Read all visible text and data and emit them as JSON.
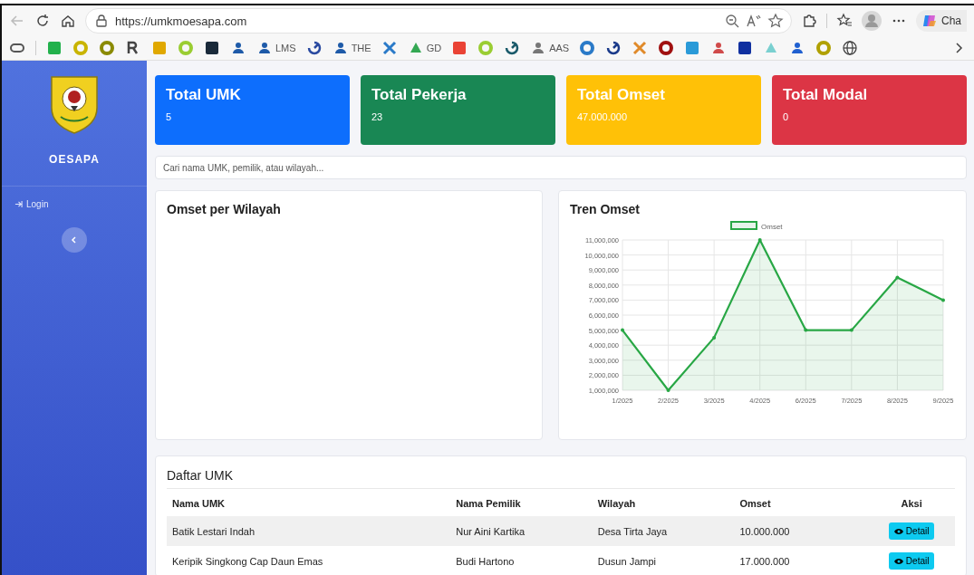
{
  "browser": {
    "url": "https://umkmoesapa.com",
    "copilot_label": "Cha",
    "bookmarks": [
      {
        "kind": "pill",
        "color": "#555555"
      },
      {
        "kind": "square",
        "color": "#22b14c"
      },
      {
        "kind": "ring",
        "color": "#c9b400"
      },
      {
        "kind": "ring",
        "color": "#8a8a00"
      },
      {
        "kind": "letter",
        "color": "#444444"
      },
      {
        "kind": "square",
        "color": "#e0a800"
      },
      {
        "kind": "ring",
        "color": "#9acd32"
      },
      {
        "kind": "square",
        "color": "#1a2a3a"
      },
      {
        "kind": "person",
        "color": "#1e5aa8"
      },
      {
        "kind": "person",
        "color": "#1e5aa8",
        "label": "LMS"
      },
      {
        "kind": "swirl",
        "color": "#2a4aa0"
      },
      {
        "kind": "person",
        "color": "#1e5aa8",
        "label": "THE"
      },
      {
        "kind": "cross",
        "color": "#2a7ac8"
      },
      {
        "kind": "triangle",
        "color": "#34a853",
        "label": "GD"
      },
      {
        "kind": "square",
        "color": "#ea4335"
      },
      {
        "kind": "ring",
        "color": "#9acd32"
      },
      {
        "kind": "swirl",
        "color": "#1a5a6a"
      },
      {
        "kind": "person",
        "color": "#777777",
        "label": "AAS"
      },
      {
        "kind": "ring",
        "color": "#2a7ac8"
      },
      {
        "kind": "swirl",
        "color": "#1a3a8a"
      },
      {
        "kind": "cross",
        "color": "#e08a2a"
      },
      {
        "kind": "ring",
        "color": "#a01010"
      },
      {
        "kind": "square",
        "color": "#2a9ad8"
      },
      {
        "kind": "person",
        "color": "#d04a4a"
      },
      {
        "kind": "square",
        "color": "#1030a0"
      },
      {
        "kind": "triangle",
        "color": "#7ad0d0"
      },
      {
        "kind": "person",
        "color": "#2060d0"
      },
      {
        "kind": "ring",
        "color": "#b0a000"
      },
      {
        "kind": "globe",
        "color": "#444444"
      }
    ]
  },
  "sidebar": {
    "brand": "OESAPA",
    "login": "Login"
  },
  "stats": [
    {
      "title": "Total UMK",
      "value": "5",
      "color": "#0d6efd"
    },
    {
      "title": "Total Pekerja",
      "value": "23",
      "color": "#198754"
    },
    {
      "title": "Total Omset",
      "value": "47.000.000",
      "color": "#ffc107"
    },
    {
      "title": "Total Modal",
      "value": "0",
      "color": "#dc3545"
    }
  ],
  "search": {
    "placeholder": "Cari nama UMK, pemilik, atau wilayah..."
  },
  "region_panel": {
    "title": "Omset per Wilayah"
  },
  "trend_panel": {
    "title": "Tren Omset",
    "chart_data": {
      "type": "area",
      "grid": true,
      "categories": [
        "1/2025",
        "2/2025",
        "3/2025",
        "4/2025",
        "6/2025",
        "7/2025",
        "8/2025",
        "9/2025"
      ],
      "series": [
        {
          "name": "Omset",
          "color": "#28a745",
          "values": [
            5000000,
            1000000,
            4500000,
            11000000,
            5000000,
            5000000,
            8500000,
            7000000
          ]
        }
      ],
      "ylim": [
        1000000,
        11000000
      ],
      "yticks": [
        {
          "value": 1000000,
          "label": "1,000,000"
        },
        {
          "value": 2000000,
          "label": "2,000,000"
        },
        {
          "value": 3000000,
          "label": "3,000,000"
        },
        {
          "value": 4000000,
          "label": "4,000,000"
        },
        {
          "value": 5000000,
          "label": "5,000,000"
        },
        {
          "value": 6000000,
          "label": "6,000,000"
        },
        {
          "value": 7000000,
          "label": "7,000,000"
        },
        {
          "value": 8000000,
          "label": "8,000,000"
        },
        {
          "value": 9000000,
          "label": "9,000,000"
        },
        {
          "value": 10000000,
          "label": "10,000,000"
        },
        {
          "value": 11000000,
          "label": "11,000,000"
        }
      ]
    }
  },
  "table": {
    "title": "Daftar UMK",
    "columns": [
      "Nama UMK",
      "Nama Pemilik",
      "Wilayah",
      "Omset",
      "Aksi"
    ],
    "rows": [
      {
        "cells": [
          "Batik Lestari Indah",
          "Nur Aini Kartika",
          "Desa Tirta Jaya",
          "10.000.000"
        ],
        "action": "Detail"
      },
      {
        "cells": [
          "Keripik Singkong Cap Daun Emas",
          "Budi Hartono",
          "Dusun Jampi",
          "17.000.000"
        ],
        "action": "Detail"
      }
    ]
  }
}
